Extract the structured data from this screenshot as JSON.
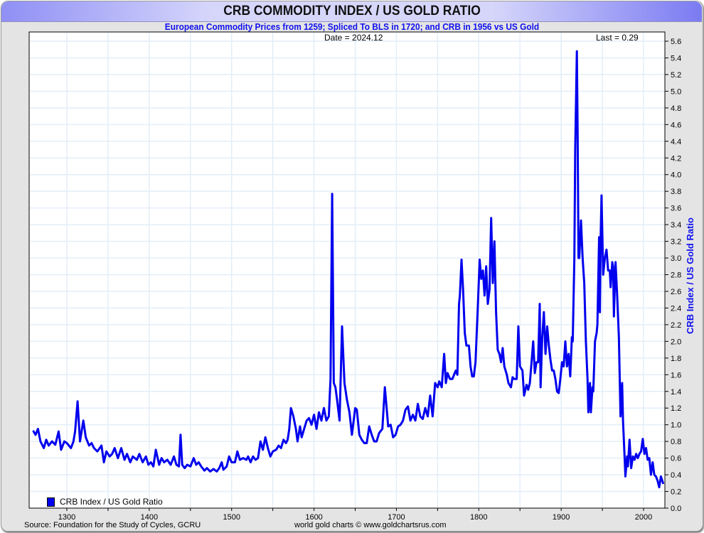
{
  "header": {
    "title": "CRB COMMODITY INDEX / US GOLD RATIO",
    "subtitle": "European Commodity Prices from 1259; Spliced To BLS in 1720; and CRB in 1956 vs US Gold"
  },
  "info": {
    "date": "Date = 2024.12",
    "last": "Last = 0.29"
  },
  "footer": {
    "source": "Source: Foundation for the Study of Cycles, GCRU",
    "credit": "world gold charts © www.goldchartsrus.com"
  },
  "colors": {
    "line": "#0000ee",
    "grid": "#e3eef8"
  },
  "chart_data": {
    "type": "line",
    "title": "CRB COMMODITY INDEX / US GOLD RATIO",
    "xlabel": "",
    "ylabel": "CRB Index / US Gold Ratio",
    "xlim": [
      1254,
      2031
    ],
    "ylim": [
      0,
      5.6
    ],
    "x_ticks": [
      1300,
      1400,
      1500,
      1600,
      1700,
      1800,
      1900,
      2000
    ],
    "y_ticks": [
      "0.0",
      "0.2",
      "0.4",
      "0.6",
      "0.8",
      "1.0",
      "1.2",
      "1.4",
      "1.6",
      "1.8",
      "2.0",
      "2.2",
      "2.4",
      "2.6",
      "2.8",
      "3.0",
      "3.2",
      "3.4",
      "3.6",
      "3.8",
      "4.0",
      "4.2",
      "4.4",
      "4.6",
      "4.8",
      "5.0",
      "5.2",
      "5.4",
      "5.6"
    ],
    "grid": true,
    "legend": {
      "position": "bottom-left",
      "entries": [
        "CRB Index / US Gold Ratio"
      ]
    },
    "series": [
      {
        "name": "CRB Index / US Gold Ratio",
        "points": [
          [
            1259,
            0.93
          ],
          [
            1262,
            0.88
          ],
          [
            1265,
            0.95
          ],
          [
            1268,
            0.8
          ],
          [
            1272,
            0.72
          ],
          [
            1275,
            0.82
          ],
          [
            1278,
            0.75
          ],
          [
            1282,
            0.8
          ],
          [
            1286,
            0.76
          ],
          [
            1290,
            0.92
          ],
          [
            1293,
            0.7
          ],
          [
            1297,
            0.8
          ],
          [
            1300,
            0.78
          ],
          [
            1305,
            0.72
          ],
          [
            1308,
            0.8
          ],
          [
            1310,
            0.92
          ],
          [
            1313,
            1.28
          ],
          [
            1316,
            0.8
          ],
          [
            1320,
            1.05
          ],
          [
            1323,
            0.85
          ],
          [
            1327,
            0.75
          ],
          [
            1330,
            0.78
          ],
          [
            1333,
            0.72
          ],
          [
            1337,
            0.68
          ],
          [
            1342,
            0.75
          ],
          [
            1345,
            0.55
          ],
          [
            1348,
            0.68
          ],
          [
            1352,
            0.62
          ],
          [
            1355,
            0.65
          ],
          [
            1358,
            0.72
          ],
          [
            1362,
            0.6
          ],
          [
            1366,
            0.72
          ],
          [
            1370,
            0.58
          ],
          [
            1373,
            0.65
          ],
          [
            1377,
            0.55
          ],
          [
            1380,
            0.62
          ],
          [
            1385,
            0.58
          ],
          [
            1388,
            0.65
          ],
          [
            1392,
            0.55
          ],
          [
            1396,
            0.62
          ],
          [
            1399,
            0.52
          ],
          [
            1402,
            0.55
          ],
          [
            1405,
            0.5
          ],
          [
            1408,
            0.7
          ],
          [
            1412,
            0.52
          ],
          [
            1415,
            0.6
          ],
          [
            1418,
            0.55
          ],
          [
            1422,
            0.58
          ],
          [
            1426,
            0.52
          ],
          [
            1430,
            0.62
          ],
          [
            1433,
            0.52
          ],
          [
            1436,
            0.5
          ],
          [
            1438,
            0.88
          ],
          [
            1440,
            0.52
          ],
          [
            1443,
            0.48
          ],
          [
            1446,
            0.52
          ],
          [
            1450,
            0.5
          ],
          [
            1454,
            0.6
          ],
          [
            1457,
            0.52
          ],
          [
            1460,
            0.55
          ],
          [
            1463,
            0.5
          ],
          [
            1467,
            0.45
          ],
          [
            1470,
            0.48
          ],
          [
            1474,
            0.44
          ],
          [
            1478,
            0.47
          ],
          [
            1482,
            0.44
          ],
          [
            1485,
            0.48
          ],
          [
            1488,
            0.55
          ],
          [
            1490,
            0.46
          ],
          [
            1494,
            0.5
          ],
          [
            1497,
            0.62
          ],
          [
            1500,
            0.55
          ],
          [
            1504,
            0.55
          ],
          [
            1507,
            0.68
          ],
          [
            1510,
            0.58
          ],
          [
            1514,
            0.6
          ],
          [
            1518,
            0.58
          ],
          [
            1520,
            0.62
          ],
          [
            1523,
            0.55
          ],
          [
            1526,
            0.62
          ],
          [
            1529,
            0.58
          ],
          [
            1532,
            0.6
          ],
          [
            1535,
            0.8
          ],
          [
            1538,
            0.7
          ],
          [
            1541,
            0.85
          ],
          [
            1544,
            0.72
          ],
          [
            1547,
            0.62
          ],
          [
            1550,
            0.68
          ],
          [
            1554,
            0.7
          ],
          [
            1557,
            0.75
          ],
          [
            1560,
            0.72
          ],
          [
            1563,
            0.82
          ],
          [
            1566,
            0.78
          ],
          [
            1568,
            0.82
          ],
          [
            1570,
            0.95
          ],
          [
            1572,
            1.2
          ],
          [
            1575,
            1.1
          ],
          [
            1578,
            0.95
          ],
          [
            1580,
            0.8
          ],
          [
            1583,
            0.98
          ],
          [
            1585,
            0.85
          ],
          [
            1588,
            0.95
          ],
          [
            1591,
            1.05
          ],
          [
            1594,
            1.08
          ],
          [
            1597,
            1.0
          ],
          [
            1600,
            1.12
          ],
          [
            1603,
            0.95
          ],
          [
            1606,
            1.15
          ],
          [
            1609,
            1.05
          ],
          [
            1612,
            1.2
          ],
          [
            1615,
            1.05
          ],
          [
            1618,
            1.1
          ],
          [
            1620,
            1.55
          ],
          [
            1622,
            3.77
          ],
          [
            1624,
            1.5
          ],
          [
            1626,
            1.45
          ],
          [
            1628,
            1.3
          ],
          [
            1631,
            1.05
          ],
          [
            1634,
            2.18
          ],
          [
            1637,
            1.5
          ],
          [
            1640,
            1.3
          ],
          [
            1643,
            1.15
          ],
          [
            1646,
            0.88
          ],
          [
            1650,
            1.2
          ],
          [
            1652,
            1.18
          ],
          [
            1655,
            0.88
          ],
          [
            1658,
            0.82
          ],
          [
            1661,
            0.78
          ],
          [
            1664,
            0.78
          ],
          [
            1667,
            0.98
          ],
          [
            1670,
            0.88
          ],
          [
            1673,
            0.8
          ],
          [
            1676,
            0.8
          ],
          [
            1679,
            0.9
          ],
          [
            1683,
            0.95
          ],
          [
            1686,
            1.45
          ],
          [
            1690,
            0.98
          ],
          [
            1693,
            1.0
          ],
          [
            1696,
            0.85
          ],
          [
            1699,
            0.88
          ],
          [
            1702,
            0.98
          ],
          [
            1705,
            1.0
          ],
          [
            1708,
            1.05
          ],
          [
            1711,
            1.18
          ],
          [
            1714,
            1.22
          ],
          [
            1717,
            1.05
          ],
          [
            1720,
            1.12
          ],
          [
            1723,
            1.05
          ],
          [
            1726,
            1.25
          ],
          [
            1729,
            1.1
          ],
          [
            1732,
            1.07
          ],
          [
            1735,
            1.2
          ],
          [
            1738,
            1.1
          ],
          [
            1741,
            1.35
          ],
          [
            1744,
            1.1
          ],
          [
            1747,
            1.5
          ],
          [
            1750,
            1.45
          ],
          [
            1752,
            1.52
          ],
          [
            1755,
            1.45
          ],
          [
            1758,
            1.85
          ],
          [
            1760,
            1.5
          ],
          [
            1762,
            1.62
          ],
          [
            1765,
            1.55
          ],
          [
            1768,
            1.55
          ],
          [
            1772,
            1.65
          ],
          [
            1774,
            1.6
          ],
          [
            1776,
            2.45
          ],
          [
            1777,
            2.55
          ],
          [
            1779,
            2.98
          ],
          [
            1781,
            2.6
          ],
          [
            1783,
            2.1
          ],
          [
            1785,
            1.95
          ],
          [
            1788,
            1.95
          ],
          [
            1790,
            1.7
          ],
          [
            1792,
            1.58
          ],
          [
            1794,
            1.58
          ],
          [
            1796,
            1.75
          ],
          [
            1799,
            2.45
          ],
          [
            1801,
            2.98
          ],
          [
            1803,
            2.75
          ],
          [
            1805,
            2.85
          ],
          [
            1807,
            2.55
          ],
          [
            1809,
            2.9
          ],
          [
            1811,
            2.45
          ],
          [
            1813,
            2.62
          ],
          [
            1815,
            3.48
          ],
          [
            1817,
            2.7
          ],
          [
            1819,
            3.2
          ],
          [
            1821,
            2.35
          ],
          [
            1823,
            1.9
          ],
          [
            1825,
            1.85
          ],
          [
            1827,
            1.75
          ],
          [
            1829,
            1.92
          ],
          [
            1831,
            1.7
          ],
          [
            1834,
            1.6
          ],
          [
            1836,
            1.5
          ],
          [
            1839,
            1.45
          ],
          [
            1841,
            1.57
          ],
          [
            1843,
            1.55
          ],
          [
            1846,
            1.55
          ],
          [
            1848,
            2.18
          ],
          [
            1850,
            1.7
          ],
          [
            1853,
            1.65
          ],
          [
            1855,
            1.35
          ],
          [
            1858,
            1.48
          ],
          [
            1860,
            1.42
          ],
          [
            1862,
            1.5
          ],
          [
            1864,
            1.75
          ],
          [
            1866,
            2.0
          ],
          [
            1868,
            1.62
          ],
          [
            1870,
            1.75
          ],
          [
            1872,
            1.75
          ],
          [
            1874,
            2.45
          ],
          [
            1875,
            1.45
          ],
          [
            1877,
            2.05
          ],
          [
            1879,
            2.35
          ],
          [
            1881,
            1.85
          ],
          [
            1883,
            2.18
          ],
          [
            1885,
            1.95
          ],
          [
            1887,
            1.78
          ],
          [
            1889,
            1.65
          ],
          [
            1891,
            1.65
          ],
          [
            1893,
            1.55
          ],
          [
            1895,
            1.4
          ],
          [
            1897,
            1.38
          ],
          [
            1899,
            1.55
          ],
          [
            1901,
            1.75
          ],
          [
            1903,
            1.7
          ],
          [
            1905,
            2.0
          ],
          [
            1907,
            1.7
          ],
          [
            1909,
            1.85
          ],
          [
            1911,
            1.58
          ],
          [
            1913,
            2.05
          ],
          [
            1914,
            2.0
          ],
          [
            1916,
            3.0
          ],
          [
            1917,
            4.3
          ],
          [
            1919,
            5.48
          ],
          [
            1920,
            4.5
          ],
          [
            1921,
            3.0
          ],
          [
            1922,
            3.0
          ],
          [
            1924,
            3.45
          ],
          [
            1926,
            3.0
          ],
          [
            1928,
            2.7
          ],
          [
            1930,
            2.0
          ],
          [
            1932,
            1.55
          ],
          [
            1933,
            1.15
          ],
          [
            1935,
            1.5
          ],
          [
            1936,
            1.15
          ],
          [
            1938,
            1.45
          ],
          [
            1939,
            1.4
          ],
          [
            1941,
            2.0
          ],
          [
            1943,
            2.1
          ],
          [
            1944,
            2.2
          ],
          [
            1946,
            3.25
          ],
          [
            1947,
            2.35
          ],
          [
            1948,
            3.3
          ],
          [
            1949,
            3.75
          ],
          [
            1951,
            2.8
          ],
          [
            1953,
            3.0
          ],
          [
            1955,
            3.1
          ],
          [
            1957,
            2.85
          ],
          [
            1959,
            2.85
          ],
          [
            1960,
            2.65
          ],
          [
            1962,
            2.95
          ],
          [
            1963,
            2.9
          ],
          [
            1964,
            2.3
          ],
          [
            1966,
            2.95
          ],
          [
            1968,
            2.55
          ],
          [
            1970,
            2.05
          ],
          [
            1972,
            1.1
          ],
          [
            1974,
            1.5
          ],
          [
            1975,
            1.05
          ],
          [
            1977,
            0.6
          ],
          [
            1978,
            0.38
          ],
          [
            1980,
            0.62
          ],
          [
            1981,
            0.5
          ],
          [
            1983,
            0.82
          ],
          [
            1985,
            0.48
          ],
          [
            1987,
            0.62
          ],
          [
            1989,
            0.58
          ],
          [
            1991,
            0.65
          ],
          [
            1993,
            0.6
          ],
          [
            1995,
            0.65
          ],
          [
            1997,
            0.68
          ],
          [
            1999,
            0.83
          ],
          [
            2001,
            0.65
          ],
          [
            2003,
            0.72
          ],
          [
            2005,
            0.58
          ],
          [
            2007,
            0.6
          ],
          [
            2009,
            0.4
          ],
          [
            2011,
            0.55
          ],
          [
            2013,
            0.4
          ],
          [
            2015,
            0.38
          ],
          [
            2017,
            0.33
          ],
          [
            2019,
            0.25
          ],
          [
            2021,
            0.38
          ],
          [
            2024,
            0.29
          ]
        ]
      }
    ]
  }
}
